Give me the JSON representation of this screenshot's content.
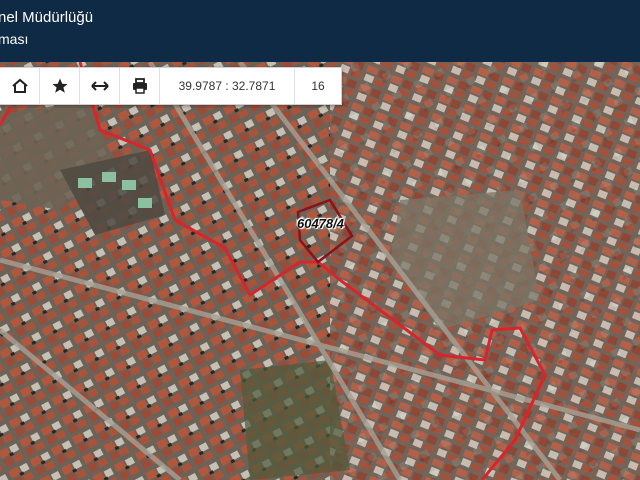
{
  "header": {
    "title_line1": "nel Müdürlüğü",
    "title_line2": "ması"
  },
  "toolbar": {
    "icons": [
      "home-icon",
      "star-icon",
      "measure-arrows-icon",
      "print-icon"
    ],
    "coordinates": "39.9787 : 32.7871",
    "zoom_level": "16"
  },
  "map": {
    "parcel_label": "60478/4",
    "boundary_color": "#d8242a",
    "parcel_color": "#8a1219"
  }
}
